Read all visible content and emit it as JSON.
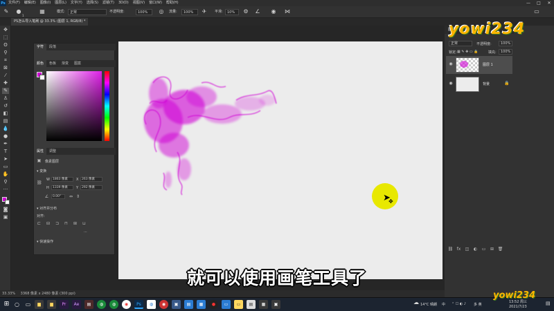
{
  "app": {
    "logo": "Ps"
  },
  "menu": [
    "文件(F)",
    "编辑(E)",
    "图像(I)",
    "图层(L)",
    "文字(Y)",
    "选择(S)",
    "滤镜(T)",
    "3D(D)",
    "视图(V)",
    "窗口(W)",
    "帮助(H)"
  ],
  "window_controls": {
    "minimize": "—",
    "maximize": "□",
    "close": "✕"
  },
  "options": {
    "mode_label": "模式:",
    "mode_value": "正常",
    "opacity_label": "不透明度:",
    "opacity_value": "100%",
    "flow_label": "流量:",
    "flow_value": "100%",
    "smooth_label": "平滑:",
    "smooth_value": "10%",
    "brush_size": "1"
  },
  "doc_tab": "PS怎么导入笔刷 @ 33.3% (图层 1, RGB/8) *",
  "left_panel": {
    "top_tabs": [
      "字符",
      "段落"
    ],
    "color_tabs": [
      "颜色",
      "色板",
      "渐变",
      "图案"
    ],
    "props_tabs": [
      "属性",
      "调整"
    ],
    "pixel_layer_label": "像素图层",
    "transform_label": "变换",
    "w_label": "W",
    "w_value": "1863 像素",
    "x_label": "X",
    "x_value": "263 像素",
    "h_label": "H",
    "h_value": "1339 像素",
    "y_label": "Y",
    "y_value": "292 像素",
    "angle_value": "0.00°",
    "align_label": "对齐并分布",
    "align_sub": "对齐:",
    "quick_label": "快速操作",
    "more": "···"
  },
  "right_panel": {
    "tabs": [
      "图层",
      "通道",
      "路径"
    ],
    "blend_value": "正常",
    "opacity_label": "不透明度:",
    "opacity_value": "100%",
    "lock_label": "锁定:",
    "fill_label": "填充:",
    "fill_value": "100%",
    "layers": [
      {
        "name": "图层 1",
        "selected": true
      },
      {
        "name": "背景",
        "selected": false
      }
    ]
  },
  "statusbar": {
    "zoom": "33.33%",
    "info": "3368 像素 x 2480 像素 (300 ppi)"
  },
  "subtitle": "就可以使用画笔工具了",
  "watermark": "yowi234",
  "taskbar": {
    "weather": "14°C 晴朗",
    "ime": "中",
    "lang": "多 英",
    "time": "13:52 周三",
    "date": "2021/7/23"
  },
  "colors": {
    "brush": "#d000d6",
    "accent": "#31a8ff",
    "highlight": "#e8e800"
  }
}
